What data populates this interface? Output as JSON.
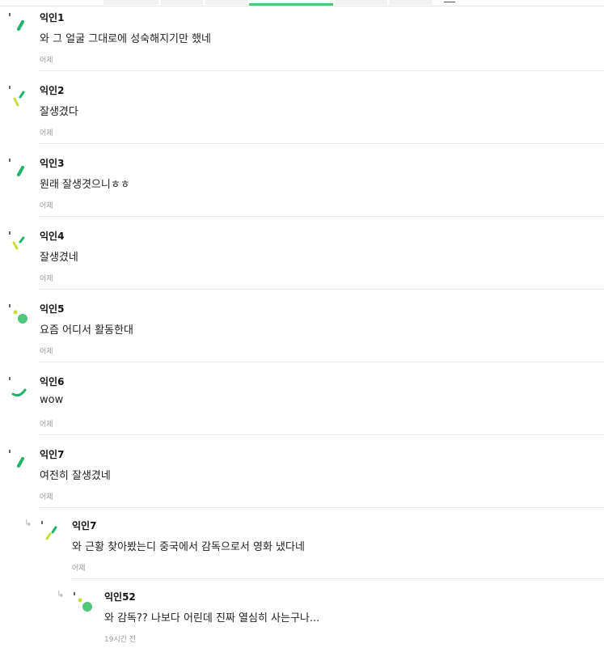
{
  "comments": [
    {
      "author": "익인1",
      "text": "와 그 얼굴 그대로에 성숙해지기만 했네",
      "time": "어제",
      "avatar_icon": "dash-icon"
    },
    {
      "author": "익인2",
      "text": "잘생겼다",
      "time": "어제",
      "avatar_icon": "double-dash-icon"
    },
    {
      "author": "익인3",
      "text": "원래 잘생겻으니ㅎㅎ",
      "time": "어제",
      "avatar_icon": "dash-icon"
    },
    {
      "author": "익인4",
      "text": "잘생겼네",
      "time": "어제",
      "avatar_icon": "double-dash-icon"
    },
    {
      "author": "익인5",
      "text": "요즘 어디서 활동한대",
      "time": "어제",
      "avatar_icon": "dot-circle-icon"
    },
    {
      "author": "익인6",
      "text": "wow",
      "time": "어제",
      "avatar_icon": "arc-icon"
    },
    {
      "author": "익인7",
      "text": "여전히 잘생겼네",
      "time": "어제",
      "avatar_icon": "dash-icon"
    }
  ],
  "replies": [
    {
      "author": "익인7",
      "text": "와 근황 찾아봤는디 중국에서 감독으로서 영화 냈다네",
      "time": "어제",
      "avatar_icon": "double-dash-icon"
    },
    {
      "author": "익인52",
      "text": "와 감독?? 나보다 어린데 진짜 열심히 사는구나...",
      "time": "19시간 전",
      "avatar_icon": "dot-circle-icon"
    }
  ],
  "reply_icon": "reply-arrow-icon",
  "colors": {
    "accent_green": "#1fb36b",
    "lime": "#c8dc3c",
    "tab_active": "#4fc77a",
    "divider": "#e9e9e9",
    "muted": "#999999"
  }
}
